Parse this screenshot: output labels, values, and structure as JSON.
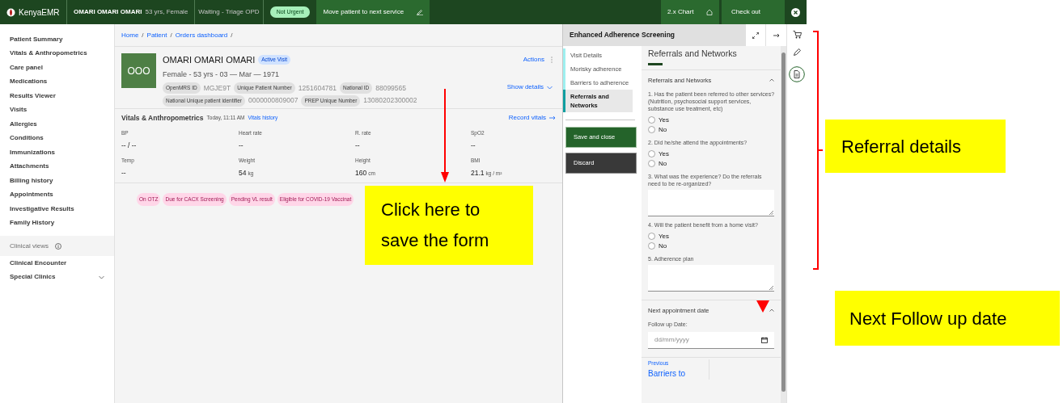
{
  "header": {
    "brand": "KenyaEMR",
    "patient_name": "OMARI OMARI OMARI",
    "patient_meta": "53 yrs, Female",
    "queue_status": "Waiting - Triage OPD",
    "priority_tag": "Not Urgent",
    "move_button": "Move patient to next service",
    "chart_button": "2.x Chart",
    "checkout_button": "Check out"
  },
  "sidebar": {
    "items": [
      "Patient Summary",
      "Vitals & Anthropometrics",
      "Care panel",
      "Medications",
      "Results Viewer",
      "Visits",
      "Allergies",
      "Conditions",
      "Immunizations",
      "Attachments",
      "Billing history",
      "Appointments",
      "Investigative Results",
      "Family History"
    ],
    "clinical_views": "Clinical views",
    "bottom_items": [
      {
        "label": "Clinical Encounter",
        "expandable": false
      },
      {
        "label": "Special Clinics",
        "expandable": true
      }
    ]
  },
  "breadcrumbs": {
    "separator": "/",
    "items": [
      "Home",
      "Patient",
      "Orders dashboard"
    ]
  },
  "patient": {
    "initials": "OOO",
    "name": "OMARI OMARI OMARI",
    "visit_badge": "Active Visit",
    "demographics": "Female - 53 yrs - 03 — Mar — 1971",
    "actions": "Actions",
    "show_details": "Show details",
    "identifiers": [
      {
        "label": "OpenMRS ID",
        "value": "MGJE9T"
      },
      {
        "label": "Unique Patient Number",
        "value": "1251604781"
      },
      {
        "label": "National ID",
        "value": "88099565"
      },
      {
        "label": "National Unique patient identifier",
        "value": "0000000809007"
      },
      {
        "label": "PREP Unique Number",
        "value": "13080202300002"
      }
    ]
  },
  "vitals": {
    "title": "Vitals & Anthropometrics",
    "time": "Today, 11:11 AM",
    "history_link": "Vitals history",
    "record_link": "Record vitals",
    "readings": [
      {
        "label": "BP",
        "value": "-- / --"
      },
      {
        "label": "Heart rate",
        "value": "--"
      },
      {
        "label": "R. rate",
        "value": "--"
      },
      {
        "label": "SpO2",
        "value": "--"
      },
      {
        "label": "Temp",
        "value": "--"
      },
      {
        "label": "Weight",
        "value": "54",
        "unit": "kg"
      },
      {
        "label": "Height",
        "value": "160",
        "unit": "cm"
      },
      {
        "label": "BMI",
        "value": "21.1",
        "unit": "kg / m²"
      }
    ]
  },
  "flags": [
    "On OTZ",
    "Due for CACX Screening",
    "Pending VL result",
    "Eligible for COVID-19 Vaccinat"
  ],
  "workspace": {
    "title": "Enhanced Adherence Screening",
    "form_nav": [
      {
        "label": "Visit Details",
        "selected": false
      },
      {
        "label": "Morisky adherence",
        "selected": false
      },
      {
        "label": "Barriers to adherence",
        "selected": false
      },
      {
        "label": "Referrals and Networks",
        "selected": true
      }
    ],
    "save_button": "Save and close",
    "discard_button": "Discard",
    "page_title": "Referrals and Networks",
    "sections": [
      {
        "title": "Referrals and Networks",
        "expanded": true,
        "questions": [
          {
            "kind": "radio",
            "label": "1. Has the patient been referred to other services? (Nutrition, psychosocial support services, substance use treatment, etc)",
            "options": [
              {
                "label": "Yes",
                "selected": false
              },
              {
                "label": "No",
                "selected": false
              }
            ]
          },
          {
            "kind": "radio",
            "label": "2. Did he/she attend the appointments?",
            "options": [
              {
                "label": "Yes",
                "selected": false
              },
              {
                "label": "No",
                "selected": false
              }
            ]
          },
          {
            "kind": "textarea",
            "label": "3. What was the experience? Do the referrals need to be re-organized?"
          },
          {
            "kind": "radio",
            "label": "4. Will the patient benefit from a home visit?",
            "options": [
              {
                "label": "Yes",
                "selected": false
              },
              {
                "label": "No",
                "selected": false
              }
            ]
          },
          {
            "kind": "textarea",
            "label": "5. Adherence plan"
          }
        ]
      },
      {
        "title": "Next appointment date",
        "expanded": true,
        "questions": [
          {
            "kind": "date",
            "label": "Follow up Date:",
            "placeholder": "dd/mm/yyyy"
          }
        ]
      }
    ],
    "previous_label": "Previous",
    "previous_page": "Barriers to"
  },
  "annotations": {
    "save_callout": "Click here to save the form",
    "referral_callout": "Referral details",
    "followup_callout": "Next Follow up date"
  }
}
